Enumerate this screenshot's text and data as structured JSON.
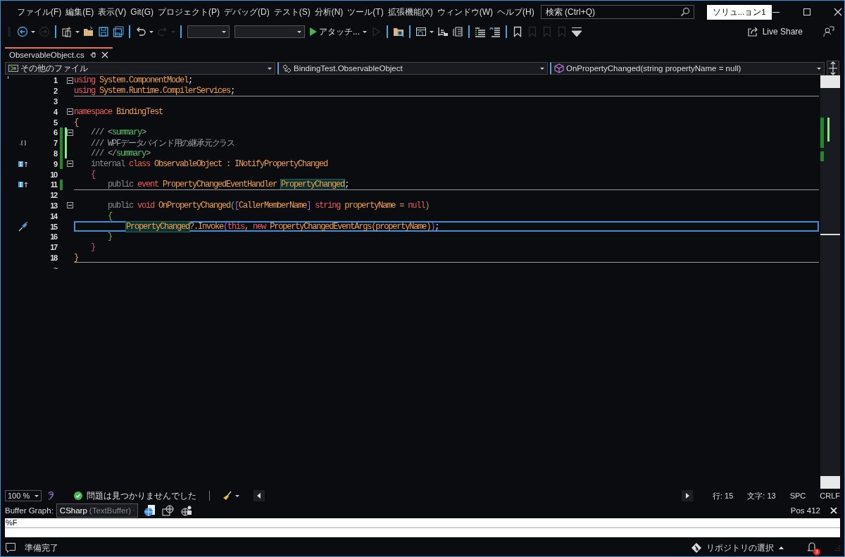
{
  "menu": [
    "ファイル(F)",
    "編集(E)",
    "表示(V)",
    "Git(G)",
    "プロジェクト(P)",
    "デバッグ(D)",
    "テスト(S)",
    "分析(N)",
    "ツール(T)",
    "拡張機能(X)",
    "ウィンドウ(W)",
    "ヘルプ(H)"
  ],
  "search": {
    "placeholder": "検索 (Ctrl+Q)"
  },
  "solution": "ソリュ...ョン1",
  "toolbar": [
    {
      "kind": "back",
      "disabled": false,
      "menu": true
    },
    {
      "kind": "forward",
      "disabled": true,
      "menu": false
    },
    {
      "kind": "sep"
    },
    {
      "kind": "new-item",
      "disabled": false,
      "menu": true
    },
    {
      "kind": "open",
      "disabled": false,
      "menu": false
    },
    {
      "kind": "save",
      "disabled": false,
      "menu": false
    },
    {
      "kind": "save-all",
      "disabled": false,
      "menu": false
    },
    {
      "kind": "sep"
    },
    {
      "kind": "undo",
      "disabled": false,
      "menu": true
    },
    {
      "kind": "redo",
      "disabled": true,
      "menu": true
    },
    {
      "kind": "sep"
    },
    {
      "kind": "combo-narrow"
    },
    {
      "kind": "combo-wide"
    },
    {
      "kind": "run",
      "label": "アタッチ...",
      "disabled": false,
      "menu": true
    },
    {
      "kind": "play",
      "disabled": true,
      "menu": false
    },
    {
      "kind": "sep"
    },
    {
      "kind": "find-folder",
      "disabled": false,
      "menu": false
    },
    {
      "kind": "sep"
    },
    {
      "kind": "window",
      "disabled": false,
      "menu": true
    },
    {
      "kind": "align",
      "disabled": false,
      "menu": false
    },
    {
      "kind": "columns",
      "disabled": false,
      "menu": false
    },
    {
      "kind": "sep"
    },
    {
      "kind": "comment",
      "disabled": false,
      "menu": false
    },
    {
      "kind": "uncomment",
      "disabled": false,
      "menu": false
    },
    {
      "kind": "sep"
    },
    {
      "kind": "bookmark",
      "disabled": false,
      "menu": false
    },
    {
      "kind": "bookmark",
      "disabled": true,
      "menu": false
    },
    {
      "kind": "bookmark",
      "disabled": true,
      "menu": false
    },
    {
      "kind": "bookmark",
      "disabled": true,
      "menu": false
    },
    {
      "kind": "overflow",
      "disabled": false,
      "menu": false
    }
  ],
  "live_share": "Live Share",
  "tabs": [
    {
      "label": "ObservableObject.cs",
      "selected": true
    }
  ],
  "nav": [
    {
      "kind": "project",
      "text": "その他のファイル"
    },
    {
      "kind": "type",
      "text": "BindingTest.ObservableObject"
    },
    {
      "kind": "member",
      "text": "OnPropertyChanged(string propertyName = null)"
    }
  ],
  "editor": {
    "lines": [
      {
        "number": "1",
        "fold": true,
        "divider": false,
        "current": false,
        "saved": false,
        "unsaved": false,
        "tokens": [
          {
            "kind": "kw",
            "text": "using"
          },
          {
            "kind": "ident",
            "text": " System.ComponentModel"
          },
          {
            "kind": "plain",
            "text": ";"
          }
        ]
      },
      {
        "number": "2",
        "fold": false,
        "divider": true,
        "current": false,
        "saved": false,
        "unsaved": false,
        "tokens": [
          {
            "kind": "kw",
            "text": "using"
          },
          {
            "kind": "ident",
            "text": " System.Runtime.CompilerServices"
          },
          {
            "kind": "plain",
            "text": ";"
          }
        ]
      },
      {
        "number": "3",
        "fold": false,
        "divider": false,
        "current": false,
        "saved": false,
        "unsaved": false
      },
      {
        "number": "4",
        "fold": true,
        "divider": false,
        "current": false,
        "saved": false,
        "unsaved": false,
        "tokens": [
          {
            "kind": "kw",
            "text": "namespace"
          },
          {
            "kind": "ident",
            "text": " BindingTest"
          }
        ]
      },
      {
        "number": "5",
        "fold": false,
        "divider": false,
        "current": false,
        "saved": false,
        "unsaved": false,
        "tokens": [
          {
            "kind": "brace1",
            "text": "{"
          }
        ]
      },
      {
        "number": "6",
        "fold": true,
        "divider": false,
        "current": false,
        "saved": true,
        "unsaved": true,
        "tokens": [
          {
            "kind": "doc",
            "text": "    /// <"
          },
          {
            "kind": "doctag",
            "text": "summary"
          },
          {
            "kind": "doc",
            "text": ">"
          }
        ]
      },
      {
        "number": "7",
        "fold": false,
        "divider": false,
        "current": false,
        "saved": true,
        "unsaved": true,
        "glyph": {
          "kind": "brackets"
        },
        "tokens": [
          {
            "kind": "doc",
            "text": "    /// WPFデータバインド用の継承元クラス"
          }
        ]
      },
      {
        "number": "8",
        "fold": false,
        "divider": false,
        "current": false,
        "saved": true,
        "unsaved": true,
        "tokens": [
          {
            "kind": "doc",
            "text": "    /// </"
          },
          {
            "kind": "doctag",
            "text": "summary"
          },
          {
            "kind": "doc",
            "text": ">"
          }
        ]
      },
      {
        "number": "9",
        "fold": true,
        "divider": false,
        "current": false,
        "saved": true,
        "unsaved": false,
        "glyph": {
          "kind": "implements"
        },
        "tokens": [
          {
            "kind": "mod",
            "text": "    internal"
          },
          {
            "kind": "kw",
            "text": " class"
          },
          {
            "kind": "ident",
            "text": " ObservableObject : INotifyPropertyChanged"
          }
        ]
      },
      {
        "number": "10",
        "fold": false,
        "divider": false,
        "current": false,
        "saved": false,
        "unsaved": false,
        "tokens": [
          {
            "kind": "brace2",
            "text": "    {"
          }
        ]
      },
      {
        "number": "11",
        "fold": false,
        "divider": true,
        "current": false,
        "saved": true,
        "unsaved": false,
        "glyph": {
          "kind": "implements"
        },
        "tokens": [
          {
            "kind": "mod",
            "text": "        public"
          },
          {
            "kind": "kw",
            "text": " event"
          },
          {
            "kind": "ident",
            "text": " PropertyChangedEventHandler "
          },
          {
            "kind": "ref",
            "text": "PropertyChanged"
          },
          {
            "kind": "plain",
            "text": ";"
          }
        ]
      },
      {
        "number": "12",
        "fold": false,
        "divider": false,
        "current": false,
        "saved": false,
        "unsaved": false
      },
      {
        "number": "13",
        "fold": true,
        "divider": false,
        "current": false,
        "saved": false,
        "unsaved": false,
        "tokens": [
          {
            "kind": "mod",
            "text": "        public"
          },
          {
            "kind": "kw",
            "text": " void"
          },
          {
            "kind": "ident",
            "text": " OnPropertyChanged"
          },
          {
            "kind": "brace3",
            "text": "("
          },
          {
            "kind": "bracket",
            "text": "["
          },
          {
            "kind": "ident",
            "text": "CallerMemberName"
          },
          {
            "kind": "bracket",
            "text": "]"
          },
          {
            "kind": "kw",
            "text": " string"
          },
          {
            "kind": "ident",
            "text": " propertyName ="
          },
          {
            "kind": "kw",
            "text": " null"
          },
          {
            "kind": "brace3",
            "text": ")"
          }
        ]
      },
      {
        "number": "14",
        "fold": false,
        "divider": false,
        "current": false,
        "saved": false,
        "unsaved": false,
        "tokens": [
          {
            "kind": "brace3",
            "text": "        {"
          }
        ]
      },
      {
        "number": "15",
        "fold": false,
        "divider": false,
        "current": true,
        "saved": false,
        "unsaved": false,
        "glyph": {
          "kind": "screwdriver"
        },
        "tokens": [
          {
            "kind": "ref",
            "text": "            PropertyChanged"
          },
          {
            "kind": "ident",
            "text": "?.Invoke"
          },
          {
            "kind": "bracket",
            "text": "("
          },
          {
            "kind": "kw",
            "text": "this"
          },
          {
            "kind": "ident",
            "text": ","
          },
          {
            "kind": "kw",
            "text": " new"
          },
          {
            "kind": "ident",
            "text": " PropertyChangedEventArgs(propertyName)"
          },
          {
            "kind": "bracket",
            "text": ")"
          },
          {
            "kind": "plain",
            "text": ";"
          }
        ]
      },
      {
        "number": "16",
        "fold": false,
        "divider": false,
        "current": false,
        "saved": false,
        "unsaved": false,
        "tokens": [
          {
            "kind": "brace3",
            "text": "        }"
          }
        ]
      },
      {
        "number": "17",
        "fold": false,
        "divider": false,
        "current": false,
        "saved": false,
        "unsaved": false,
        "tokens": [
          {
            "kind": "brace2",
            "text": "    }"
          }
        ]
      },
      {
        "number": "18",
        "fold": false,
        "divider": true,
        "current": false,
        "saved": false,
        "unsaved": false,
        "tokens": [
          {
            "kind": "brace1",
            "text": "}"
          }
        ]
      }
    ],
    "end_marker": "~"
  },
  "editor_status": {
    "zoom": "100 %",
    "issues": "問題は見つかりませんでした",
    "line": "行: 15",
    "column": "文字: 13",
    "whitespace": "SPC",
    "line_ending": "CRLF"
  },
  "buffer_graph": {
    "label": "Buffer Graph:",
    "buffer": "CSharp",
    "buffer_kind": "(TextBuffer)",
    "position": "Pos 412",
    "text": "%F"
  },
  "status_bar": {
    "message": "準備完了",
    "repository": "リポジトリの選択",
    "notifications": "3"
  }
}
